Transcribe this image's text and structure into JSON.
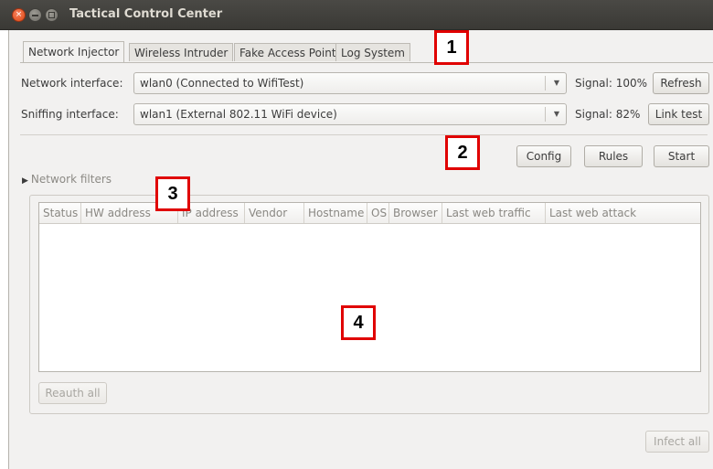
{
  "window": {
    "title": "Tactical Control Center"
  },
  "tabs": [
    {
      "label": "Network Injector",
      "active": true
    },
    {
      "label": "Wireless Intruder",
      "active": false
    },
    {
      "label": "Fake Access Point",
      "active": false
    },
    {
      "label": "Log System",
      "active": false
    }
  ],
  "network_interface": {
    "label": "Network interface:",
    "value": "wlan0 (Connected to WifiTest)",
    "signal": "Signal: 100%",
    "button": "Refresh"
  },
  "sniffing_interface": {
    "label": "Sniffing interface:",
    "value": "wlan1 (External 802.11 WiFi device)",
    "signal": "Signal: 82%",
    "button": "Link test"
  },
  "actions": {
    "config": "Config",
    "rules": "Rules",
    "start": "Start"
  },
  "filters": {
    "label": "Network filters",
    "expanded": false
  },
  "table": {
    "columns": [
      "Status",
      "HW address",
      "IP address",
      "Vendor",
      "Hostname",
      "OS",
      "Browser",
      "Last web traffic",
      "Last web attack"
    ],
    "rows": []
  },
  "buttons": {
    "reauth_all": "Reauth all",
    "infect_all": "Infect all"
  },
  "markers": [
    "1",
    "2",
    "3",
    "4"
  ],
  "colors": {
    "marker_border": "#e00000",
    "titlebar": "#3c3b37",
    "close_button": "#dd4814"
  }
}
